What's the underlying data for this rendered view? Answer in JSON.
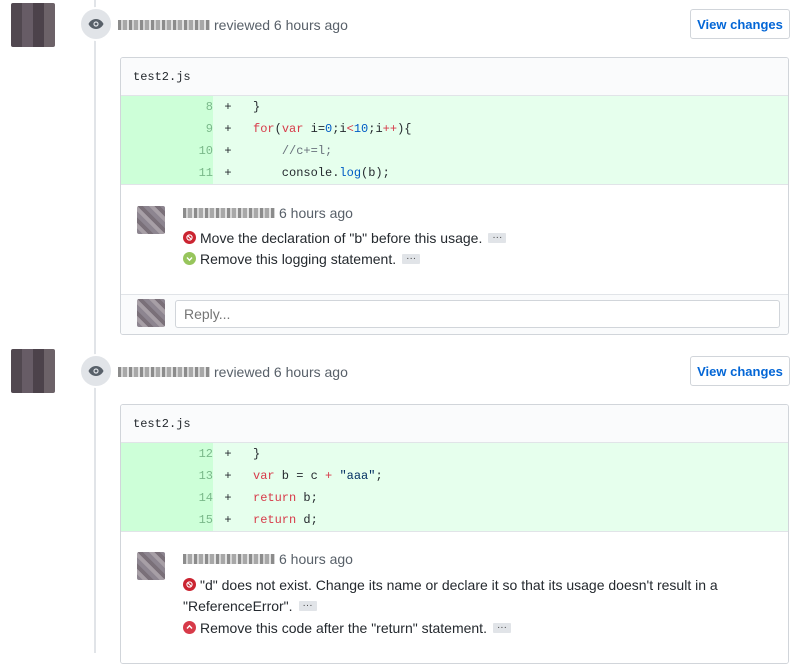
{
  "reviews": [
    {
      "action": "reviewed 6 hours ago",
      "view_changes": "View changes",
      "file": "test2.js",
      "diff": [
        {
          "num": "8",
          "sign": "+"
        },
        {
          "num": "9",
          "sign": "+"
        },
        {
          "num": "10",
          "sign": "+"
        },
        {
          "num": "11",
          "sign": "+"
        }
      ],
      "comment": {
        "time": "6 hours ago",
        "items": [
          {
            "type": "error",
            "text": "Move the declaration of \"b\" before this usage.",
            "more": "···"
          },
          {
            "type": "info",
            "text": "Remove this logging statement.",
            "more": "···"
          }
        ]
      },
      "reply_placeholder": "Reply..."
    },
    {
      "action": "reviewed 6 hours ago",
      "view_changes": "View changes",
      "file": "test2.js",
      "diff": [
        {
          "num": "12",
          "sign": "+"
        },
        {
          "num": "13",
          "sign": "+"
        },
        {
          "num": "14",
          "sign": "+"
        },
        {
          "num": "15",
          "sign": "+"
        }
      ],
      "comment": {
        "time": "6 hours ago",
        "items": [
          {
            "type": "error",
            "text_line1": "\"d\" does not exist. Change its name or declare it so that its usage doesn't result in a",
            "text_line2": "\"ReferenceError\".",
            "more": "···"
          },
          {
            "type": "critical",
            "text": "Remove this code after the \"return\" statement.",
            "more": "···"
          }
        ]
      }
    }
  ],
  "colors": {
    "link": "#0366d6",
    "added_bg": "#e6ffed",
    "added_num_bg": "#cdffd8",
    "error": "#cb2431",
    "info": "#97c55c",
    "critical": "#d73a49"
  }
}
